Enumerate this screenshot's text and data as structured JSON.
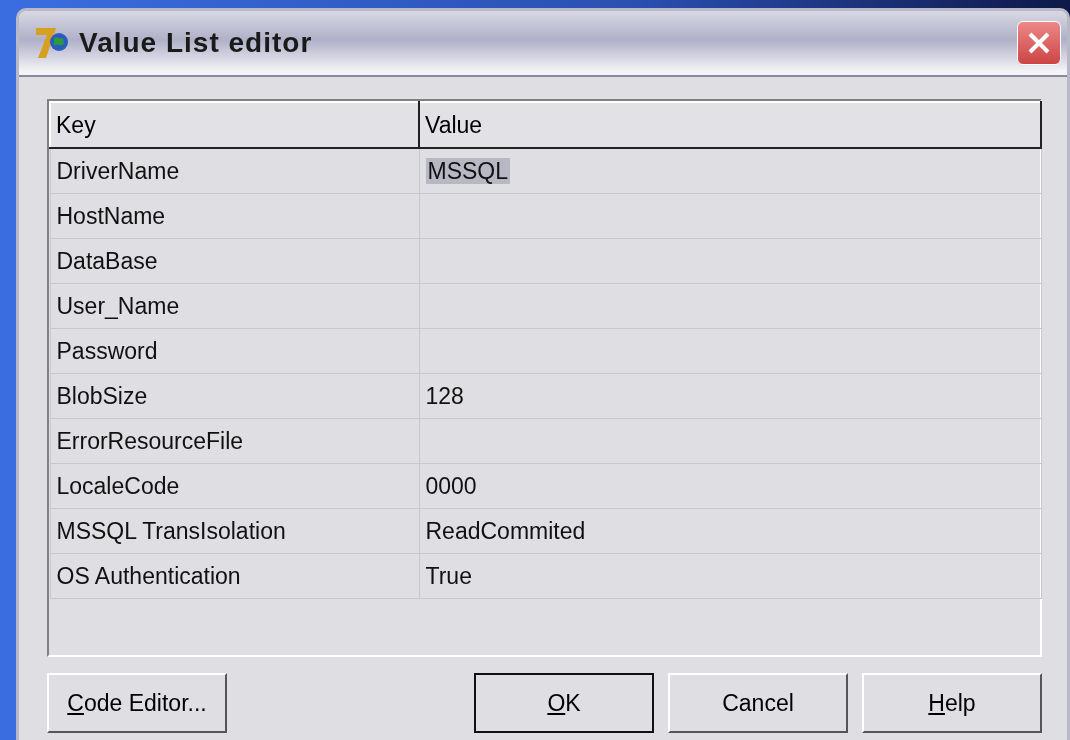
{
  "window": {
    "title": "Value List editor"
  },
  "table": {
    "columns": [
      "Key",
      "Value"
    ],
    "rows": [
      {
        "key": "DriverName",
        "value": "MSSQL",
        "selected": true
      },
      {
        "key": "HostName",
        "value": null,
        "selected": false
      },
      {
        "key": "DataBase",
        "value": null,
        "selected": false
      },
      {
        "key": "User_Name",
        "value": null,
        "selected": false
      },
      {
        "key": "Password",
        "value": null,
        "selected": false
      },
      {
        "key": "BlobSize",
        "value": "128",
        "selected": false
      },
      {
        "key": "ErrorResourceFile",
        "value": null,
        "selected": false
      },
      {
        "key": "LocaleCode",
        "value": "0000",
        "selected": false
      },
      {
        "key": "MSSQL TransIsolation",
        "value": "ReadCommited",
        "selected": false
      },
      {
        "key": "OS Authentication",
        "value": "True",
        "selected": false
      }
    ]
  },
  "buttons": [
    {
      "label": "Code Editor...",
      "underline_first": true,
      "default": false
    },
    {
      "label": "OK",
      "underline_first": true,
      "default": true
    },
    {
      "label": "Cancel",
      "underline_first": false,
      "default": false
    },
    {
      "label": "Help",
      "underline_first": true,
      "default": false
    }
  ]
}
